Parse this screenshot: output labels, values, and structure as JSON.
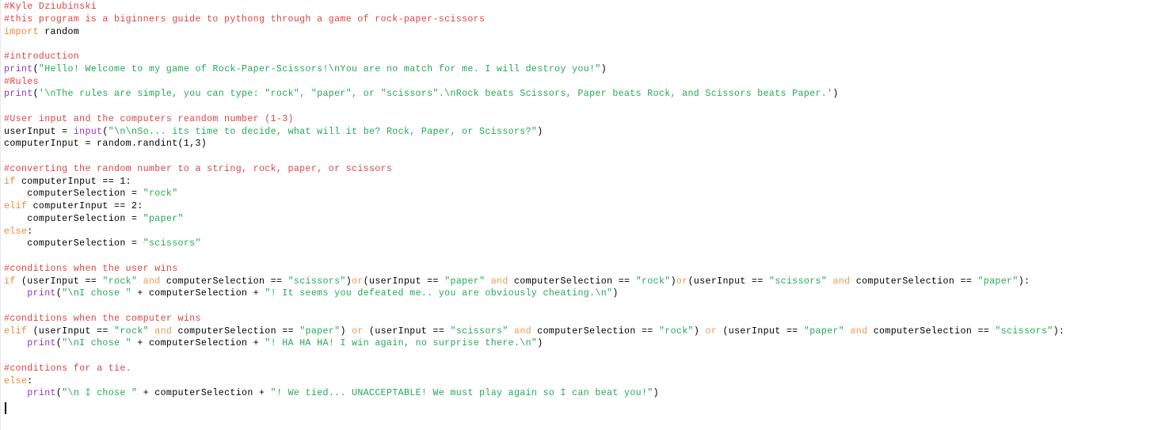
{
  "app": {
    "type": "code-editor",
    "language": "Python",
    "background": "#ffffff",
    "caret_visible": true
  },
  "colors": {
    "comment": "#dd4444",
    "keyword": "#ee8833",
    "operator": "#ee9955",
    "builtin": "#9933cc",
    "string": "#22aa55",
    "plain": "#000000",
    "background": "#ffffff",
    "left_rule": "#e9e9ee",
    "caret": "#000000"
  },
  "code": {
    "lines": [
      {
        "n": 1,
        "tokens": [
          {
            "t": "comment",
            "s": "#Kyle Dziubinski"
          }
        ]
      },
      {
        "n": 2,
        "tokens": [
          {
            "t": "comment",
            "s": "#this program is a biginners guide to pythong through a game of rock-paper-scissors"
          }
        ]
      },
      {
        "n": 3,
        "tokens": [
          {
            "t": "keyword",
            "s": "import"
          },
          {
            "t": "plain",
            "s": " random"
          }
        ]
      },
      {
        "n": 4,
        "tokens": []
      },
      {
        "n": 5,
        "tokens": [
          {
            "t": "comment",
            "s": "#introduction"
          }
        ]
      },
      {
        "n": 6,
        "tokens": [
          {
            "t": "builtin",
            "s": "print"
          },
          {
            "t": "plain",
            "s": "("
          },
          {
            "t": "string",
            "s": "\"Hello! Welcome to my game of Rock-Paper-Scissors!\\nYou are no match for me. I will destroy you!\""
          },
          {
            "t": "plain",
            "s": ")"
          }
        ]
      },
      {
        "n": 7,
        "tokens": [
          {
            "t": "comment",
            "s": "#Rules"
          }
        ]
      },
      {
        "n": 8,
        "tokens": [
          {
            "t": "builtin",
            "s": "print"
          },
          {
            "t": "plain",
            "s": "("
          },
          {
            "t": "string",
            "s": "'\\nThe rules are simple, you can type: \"rock\", \"paper\", or \"scissors\".\\nRock beats Scissors, Paper beats Rock, and Scissors beats Paper.'"
          },
          {
            "t": "plain",
            "s": ")"
          }
        ]
      },
      {
        "n": 9,
        "tokens": []
      },
      {
        "n": 10,
        "tokens": [
          {
            "t": "comment",
            "s": "#User input and the computers reandom number (1-3)"
          }
        ]
      },
      {
        "n": 11,
        "tokens": [
          {
            "t": "plain",
            "s": "userInput = "
          },
          {
            "t": "builtin",
            "s": "input"
          },
          {
            "t": "plain",
            "s": "("
          },
          {
            "t": "string",
            "s": "\"\\n\\nSo... its time to decide, what will it be? Rock, Paper, or Scissors?\""
          },
          {
            "t": "plain",
            "s": ")"
          }
        ]
      },
      {
        "n": 12,
        "tokens": [
          {
            "t": "plain",
            "s": "computerInput = random.randint(1,3)"
          }
        ]
      },
      {
        "n": 13,
        "tokens": []
      },
      {
        "n": 14,
        "tokens": [
          {
            "t": "comment",
            "s": "#converting the random number to a string, rock, paper, or scissors"
          }
        ]
      },
      {
        "n": 15,
        "tokens": [
          {
            "t": "keyword",
            "s": "if"
          },
          {
            "t": "plain",
            "s": " computerInput == 1:"
          }
        ]
      },
      {
        "n": 16,
        "tokens": [
          {
            "t": "plain",
            "s": "    computerSelection = "
          },
          {
            "t": "string",
            "s": "\"rock\""
          }
        ]
      },
      {
        "n": 17,
        "tokens": [
          {
            "t": "keyword",
            "s": "elif"
          },
          {
            "t": "plain",
            "s": " computerInput == 2:"
          }
        ]
      },
      {
        "n": 18,
        "tokens": [
          {
            "t": "plain",
            "s": "    computerSelection = "
          },
          {
            "t": "string",
            "s": "\"paper\""
          }
        ]
      },
      {
        "n": 19,
        "tokens": [
          {
            "t": "keyword",
            "s": "else"
          },
          {
            "t": "plain",
            "s": ":"
          }
        ]
      },
      {
        "n": 20,
        "tokens": [
          {
            "t": "plain",
            "s": "    computerSelection = "
          },
          {
            "t": "string",
            "s": "\"scissors\""
          }
        ]
      },
      {
        "n": 21,
        "tokens": []
      },
      {
        "n": 22,
        "tokens": [
          {
            "t": "comment",
            "s": "#conditions when the user wins"
          }
        ]
      },
      {
        "n": 23,
        "tokens": [
          {
            "t": "keyword",
            "s": "if"
          },
          {
            "t": "plain",
            "s": " (userInput == "
          },
          {
            "t": "string",
            "s": "\"rock\""
          },
          {
            "t": "plain",
            "s": " "
          },
          {
            "t": "operator",
            "s": "and"
          },
          {
            "t": "plain",
            "s": " computerSelection == "
          },
          {
            "t": "string",
            "s": "\"scissors\""
          },
          {
            "t": "plain",
            "s": ")"
          },
          {
            "t": "operator",
            "s": "or"
          },
          {
            "t": "plain",
            "s": "(userInput == "
          },
          {
            "t": "string",
            "s": "\"paper\""
          },
          {
            "t": "plain",
            "s": " "
          },
          {
            "t": "operator",
            "s": "and"
          },
          {
            "t": "plain",
            "s": " computerSelection == "
          },
          {
            "t": "string",
            "s": "\"rock\""
          },
          {
            "t": "plain",
            "s": ")"
          },
          {
            "t": "operator",
            "s": "or"
          },
          {
            "t": "plain",
            "s": "(userInput == "
          },
          {
            "t": "string",
            "s": "\"scissors\""
          },
          {
            "t": "plain",
            "s": " "
          },
          {
            "t": "operator",
            "s": "and"
          },
          {
            "t": "plain",
            "s": " computerSelection == "
          },
          {
            "t": "string",
            "s": "\"paper\""
          },
          {
            "t": "plain",
            "s": "):"
          }
        ]
      },
      {
        "n": 24,
        "tokens": [
          {
            "t": "plain",
            "s": "    "
          },
          {
            "t": "builtin",
            "s": "print"
          },
          {
            "t": "plain",
            "s": "("
          },
          {
            "t": "string",
            "s": "\"\\nI chose \""
          },
          {
            "t": "plain",
            "s": " + computerSelection + "
          },
          {
            "t": "string",
            "s": "\"! It seems you defeated me.. you are obviously cheating.\\n\""
          },
          {
            "t": "plain",
            "s": ")"
          }
        ]
      },
      {
        "n": 25,
        "tokens": []
      },
      {
        "n": 26,
        "tokens": [
          {
            "t": "comment",
            "s": "#conditions when the computer wins"
          }
        ]
      },
      {
        "n": 27,
        "tokens": [
          {
            "t": "keyword",
            "s": "elif"
          },
          {
            "t": "plain",
            "s": " (userInput == "
          },
          {
            "t": "string",
            "s": "\"rock\""
          },
          {
            "t": "plain",
            "s": " "
          },
          {
            "t": "operator",
            "s": "and"
          },
          {
            "t": "plain",
            "s": " computerSelection == "
          },
          {
            "t": "string",
            "s": "\"paper\""
          },
          {
            "t": "plain",
            "s": ") "
          },
          {
            "t": "operator",
            "s": "or"
          },
          {
            "t": "plain",
            "s": " (userInput == "
          },
          {
            "t": "string",
            "s": "\"scissors\""
          },
          {
            "t": "plain",
            "s": " "
          },
          {
            "t": "operator",
            "s": "and"
          },
          {
            "t": "plain",
            "s": " computerSelection == "
          },
          {
            "t": "string",
            "s": "\"rock\""
          },
          {
            "t": "plain",
            "s": ") "
          },
          {
            "t": "operator",
            "s": "or"
          },
          {
            "t": "plain",
            "s": " (userInput == "
          },
          {
            "t": "string",
            "s": "\"paper\""
          },
          {
            "t": "plain",
            "s": " "
          },
          {
            "t": "operator",
            "s": "and"
          },
          {
            "t": "plain",
            "s": " computerSelection == "
          },
          {
            "t": "string",
            "s": "\"scissors\""
          },
          {
            "t": "plain",
            "s": "):"
          }
        ]
      },
      {
        "n": 28,
        "tokens": [
          {
            "t": "plain",
            "s": "    "
          },
          {
            "t": "builtin",
            "s": "print"
          },
          {
            "t": "plain",
            "s": "("
          },
          {
            "t": "string",
            "s": "\"\\nI chose \""
          },
          {
            "t": "plain",
            "s": " + computerSelection + "
          },
          {
            "t": "string",
            "s": "\"! HA HA HA! I win again, no surprise there.\\n\""
          },
          {
            "t": "plain",
            "s": ")"
          }
        ]
      },
      {
        "n": 29,
        "tokens": []
      },
      {
        "n": 30,
        "tokens": [
          {
            "t": "comment",
            "s": "#conditions for a tie."
          }
        ]
      },
      {
        "n": 31,
        "tokens": [
          {
            "t": "keyword",
            "s": "else"
          },
          {
            "t": "plain",
            "s": ":"
          }
        ]
      },
      {
        "n": 32,
        "tokens": [
          {
            "t": "plain",
            "s": "    "
          },
          {
            "t": "builtin",
            "s": "print"
          },
          {
            "t": "plain",
            "s": "("
          },
          {
            "t": "string",
            "s": "\"\\n I chose \""
          },
          {
            "t": "plain",
            "s": " + computerSelection + "
          },
          {
            "t": "string",
            "s": "\"! We tied... UNACCEPTABLE! We must play again so I can beat you!\""
          },
          {
            "t": "plain",
            "s": ")"
          }
        ]
      },
      {
        "n": 33,
        "tokens": []
      }
    ]
  }
}
